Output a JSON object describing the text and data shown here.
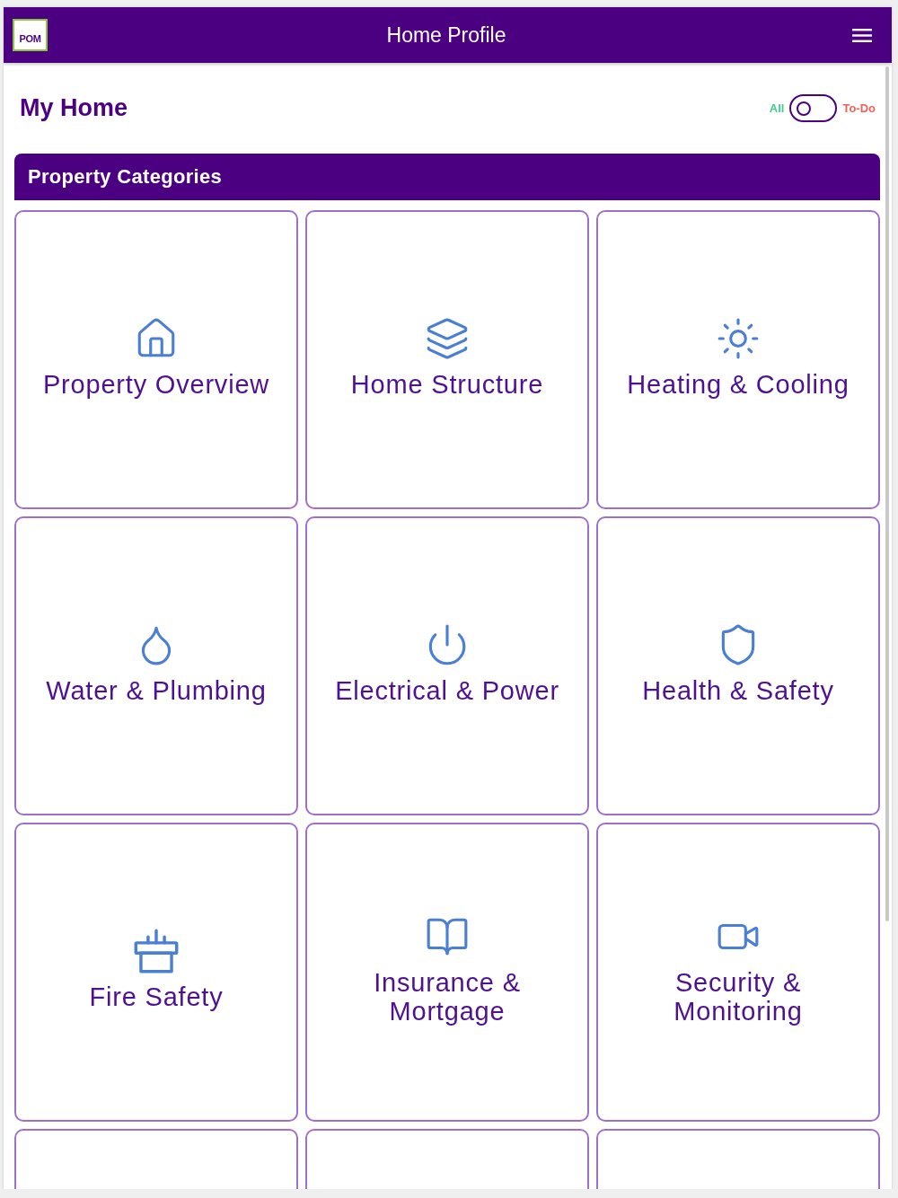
{
  "header": {
    "logo": "POM",
    "title": "Home Profile"
  },
  "page": {
    "title": "My Home",
    "toggle": {
      "left_label": "All",
      "right_label": "To-Do",
      "on": false
    }
  },
  "section": {
    "title": "Property Categories"
  },
  "categories": [
    {
      "kind": "category",
      "label": "Property Overview"
    },
    {
      "kind": "category",
      "label": "Home Structure"
    },
    {
      "kind": "category",
      "label": "Heating & Cooling"
    },
    {
      "kind": "category",
      "label": "Water & Plumbing"
    },
    {
      "kind": "category",
      "label": "Electrical & Power"
    },
    {
      "kind": "category",
      "label": "Health & Safety"
    },
    {
      "kind": "category",
      "label": "Fire Safety"
    },
    {
      "kind": "category",
      "label": "Insurance & Mortgage"
    },
    {
      "kind": "category",
      "label": "Security & Monitoring"
    },
    {
      "kind": "blank"
    },
    {
      "kind": "blank"
    },
    {
      "kind": "blank"
    }
  ]
}
